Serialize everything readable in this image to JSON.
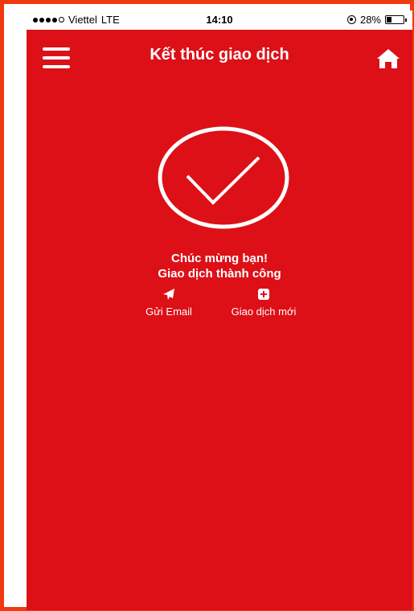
{
  "status_bar": {
    "carrier": "Viettel",
    "network": "LTE",
    "time": "14:10",
    "battery": "28%",
    "battery_level": 0.28
  },
  "header": {
    "title": "Kết thúc giao dịch",
    "menu_icon": "hamburger-menu-icon",
    "home_icon": "home-icon"
  },
  "result": {
    "icon": "check-circle-icon",
    "line1": "Chúc mừng bạn!",
    "line2": "Giao dịch thành công"
  },
  "actions": {
    "send_email": {
      "label": "Gửi Email",
      "icon": "paper-plane-icon"
    },
    "new_transaction": {
      "label": "Giao dịch mới",
      "icon": "plus-square-icon"
    }
  },
  "colors": {
    "background": "#dd1017",
    "border": "#f2380f",
    "foreground": "#ffffff"
  }
}
